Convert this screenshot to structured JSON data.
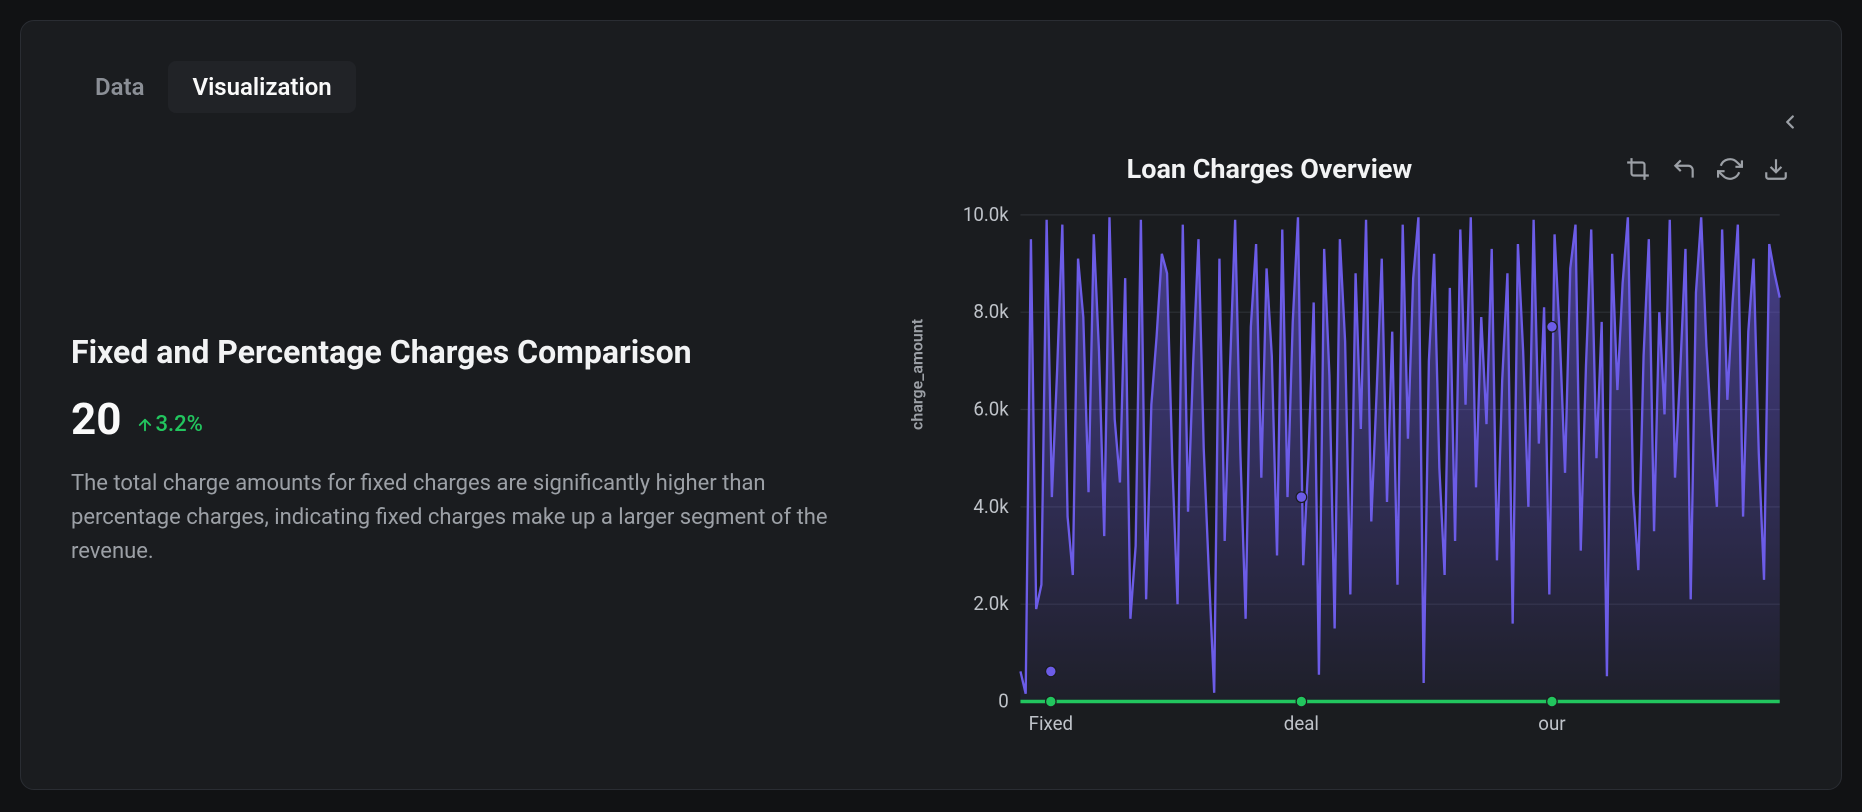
{
  "tabs": {
    "data": "Data",
    "visualization": "Visualization"
  },
  "left": {
    "title": "Fixed and Percentage Charges Comparison",
    "metric": "20",
    "delta": "3.2%",
    "description": "The total charge amounts for fixed charges are significantly higher than percentage charges, indicating fixed charges make up a larger segment of the revenue."
  },
  "chart": {
    "title": "Loan Charges Overview",
    "ylabel": "charge_amount"
  },
  "chart_data": {
    "type": "area",
    "title": "Loan Charges Overview",
    "xlabel": "",
    "ylabel": "charge_amount",
    "ylim": [
      0,
      10000
    ],
    "yticks": [
      "0",
      "2.0k",
      "4.0k",
      "6.0k",
      "8.0k",
      "10.0k"
    ],
    "xticks": [
      {
        "label": "Fixed",
        "pos": 0.04
      },
      {
        "label": "deal",
        "pos": 0.37
      },
      {
        "label": "our",
        "pos": 0.7
      }
    ],
    "series": [
      {
        "name": "charge_amount",
        "color": "#6c5ce7",
        "values": [
          620,
          160,
          9500,
          1900,
          2400,
          9900,
          4200,
          6800,
          9800,
          3800,
          2600,
          9100,
          7900,
          4300,
          9600,
          7200,
          3400,
          9950,
          5800,
          4500,
          8700,
          1700,
          3200,
          9900,
          2100,
          6100,
          7500,
          9200,
          8800,
          4900,
          2000,
          9800,
          3900,
          7000,
          9500,
          5200,
          2600,
          180,
          9100,
          3300,
          6800,
          9900,
          5100,
          1700,
          7700,
          9400,
          4600,
          8900,
          7100,
          3000,
          9700,
          4200,
          7800,
          9950,
          2800,
          5000,
          8200,
          550,
          9300,
          6700,
          1500,
          9500,
          7400,
          2200,
          8800,
          5600,
          9900,
          3700,
          6300,
          9100,
          4100,
          7600,
          2400,
          9800,
          5400,
          8700,
          9950,
          380,
          7000,
          9200,
          4800,
          2600,
          8500,
          3300,
          9700,
          6100,
          9950,
          4400,
          7900,
          5700,
          9300,
          2900,
          6600,
          8800,
          1600,
          9400,
          7200,
          4000,
          9900,
          5300,
          8100,
          2200,
          9600,
          7500,
          4700,
          8900,
          9800,
          3100,
          6900,
          9700,
          5000,
          7800,
          520,
          9200,
          6400,
          8600,
          9950,
          4300,
          2700,
          7100,
          9500,
          3500,
          8000,
          5900,
          9900,
          4600,
          6800,
          9300,
          2100,
          8400,
          9950,
          7300,
          5500,
          4000,
          9700,
          6200,
          8200,
          9800,
          3800,
          7600,
          9100,
          5100,
          2500,
          9400,
          8800,
          8300
        ]
      },
      {
        "name": "baseline",
        "color": "#22c55e",
        "values": [
          0,
          0,
          0,
          0,
          0,
          0,
          0,
          0,
          0,
          0,
          0,
          0,
          0,
          0,
          0,
          0,
          0,
          0,
          0,
          0,
          0,
          0,
          0,
          0,
          0,
          0,
          0,
          0,
          0,
          0,
          0,
          0,
          0,
          0,
          0,
          0,
          0,
          0,
          0,
          0,
          0,
          0,
          0,
          0,
          0,
          0,
          0,
          0,
          0,
          0,
          0,
          0,
          0,
          0,
          0,
          0,
          0,
          0,
          0,
          0,
          0,
          0,
          0,
          0,
          0,
          0,
          0,
          0,
          0,
          0,
          0,
          0,
          0,
          0,
          0,
          0,
          0,
          0,
          0,
          0,
          0,
          0,
          0,
          0,
          0,
          0,
          0,
          0,
          0,
          0,
          0,
          0,
          0,
          0,
          0,
          0,
          0,
          0,
          0,
          0,
          0,
          0,
          0,
          0,
          0,
          0,
          0,
          0,
          0,
          0,
          0,
          0,
          0,
          0,
          0,
          0,
          0,
          0,
          0,
          0,
          0,
          0,
          0,
          0,
          0,
          0,
          0,
          0,
          0,
          0,
          0,
          0,
          0,
          0,
          0,
          0,
          0,
          0,
          0,
          0,
          0,
          0,
          0,
          0,
          0
        ]
      }
    ],
    "markers": [
      {
        "x": 0.04,
        "y": 620,
        "color": "#6c5ce7"
      },
      {
        "x": 0.37,
        "y": 4200,
        "color": "#6c5ce7"
      },
      {
        "x": 0.7,
        "y": 7700,
        "color": "#6c5ce7"
      },
      {
        "x": 0.04,
        "y": 0,
        "color": "#22c55e"
      },
      {
        "x": 0.37,
        "y": 0,
        "color": "#22c55e"
      },
      {
        "x": 0.7,
        "y": 0,
        "color": "#22c55e"
      }
    ]
  }
}
